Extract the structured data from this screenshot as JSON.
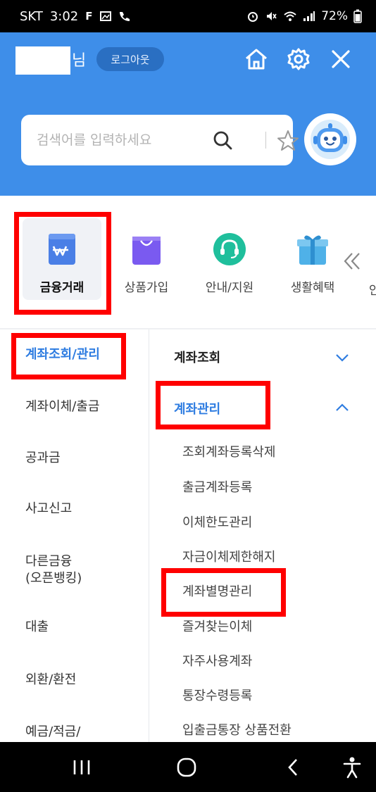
{
  "status_bar": {
    "carrier": "SKT",
    "time": "3:02",
    "battery": "72%"
  },
  "header": {
    "name_suffix": "님",
    "logout_label": "로그아웃",
    "search": {
      "placeholder": "검색어를 입력하세요"
    }
  },
  "categories": [
    {
      "label": "금융거래",
      "icon": "wallet-icon"
    },
    {
      "label": "상품가입",
      "icon": "shopping-bag-icon"
    },
    {
      "label": "안내/지원",
      "icon": "headset-icon"
    },
    {
      "label": "생활혜택",
      "icon": "gift-icon"
    }
  ],
  "category_cut_label": "안",
  "left_nav": [
    {
      "label": "계좌조회/관리"
    },
    {
      "label": "계좌이체/출금"
    },
    {
      "label": "공과금"
    },
    {
      "label": "사고신고"
    },
    {
      "label": "다른금융\n(오픈뱅킹)"
    },
    {
      "label": "대출"
    },
    {
      "label": "외환/환전"
    },
    {
      "label": "예금/적금/"
    }
  ],
  "right_menu": {
    "sections": [
      {
        "label": "계좌조회"
      },
      {
        "label": "계좌관리"
      }
    ],
    "items": [
      "조회계좌등록삭제",
      "출금계좌등록",
      "이체한도관리",
      "자금이체제한해지",
      "계좌별명관리",
      "즐겨찾는이체",
      "자주사용계좌",
      "통장수령등록",
      "입출금통장 상품전환"
    ]
  },
  "colors": {
    "header_blue": "#3e8ee9",
    "accent_blue": "#2f7de1",
    "highlight_red": "#ff0000"
  }
}
